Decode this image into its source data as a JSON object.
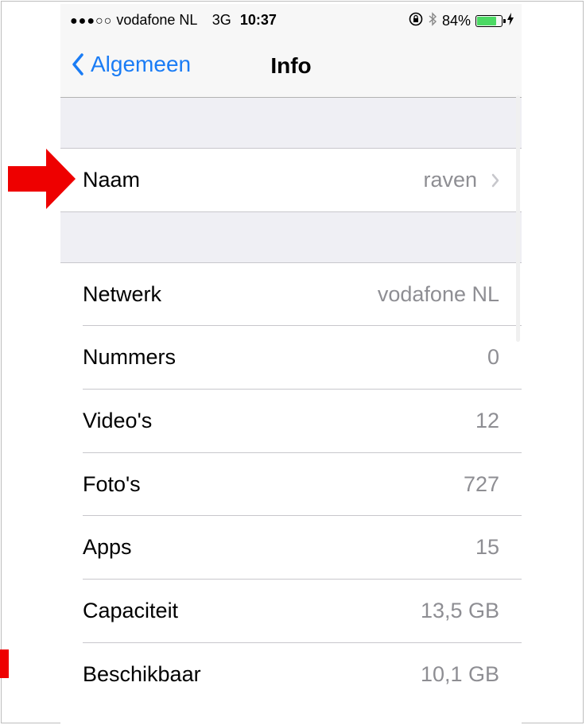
{
  "status_bar": {
    "signal": "●●●○○",
    "carrier": "vodafone NL",
    "network": "3G",
    "time": "10:37",
    "battery": "84%",
    "battery_level": 0.84
  },
  "nav": {
    "back_label": "Algemeen",
    "title": "Info"
  },
  "name_row": {
    "label": "Naam",
    "value": "raven"
  },
  "rows": [
    {
      "label": "Netwerk",
      "value": "vodafone NL"
    },
    {
      "label": "Nummers",
      "value": "0"
    },
    {
      "label": "Video's",
      "value": "12"
    },
    {
      "label": "Foto's",
      "value": "727"
    },
    {
      "label": "Apps",
      "value": "15"
    },
    {
      "label": "Capaciteit",
      "value": "13,5 GB"
    },
    {
      "label": "Beschikbaar",
      "value": "10,1 GB"
    }
  ],
  "colors": {
    "accent": "#1a7cf5",
    "annotation": "#ee0000",
    "battery": "#4cd964",
    "secondary_text": "#8e8e93"
  }
}
